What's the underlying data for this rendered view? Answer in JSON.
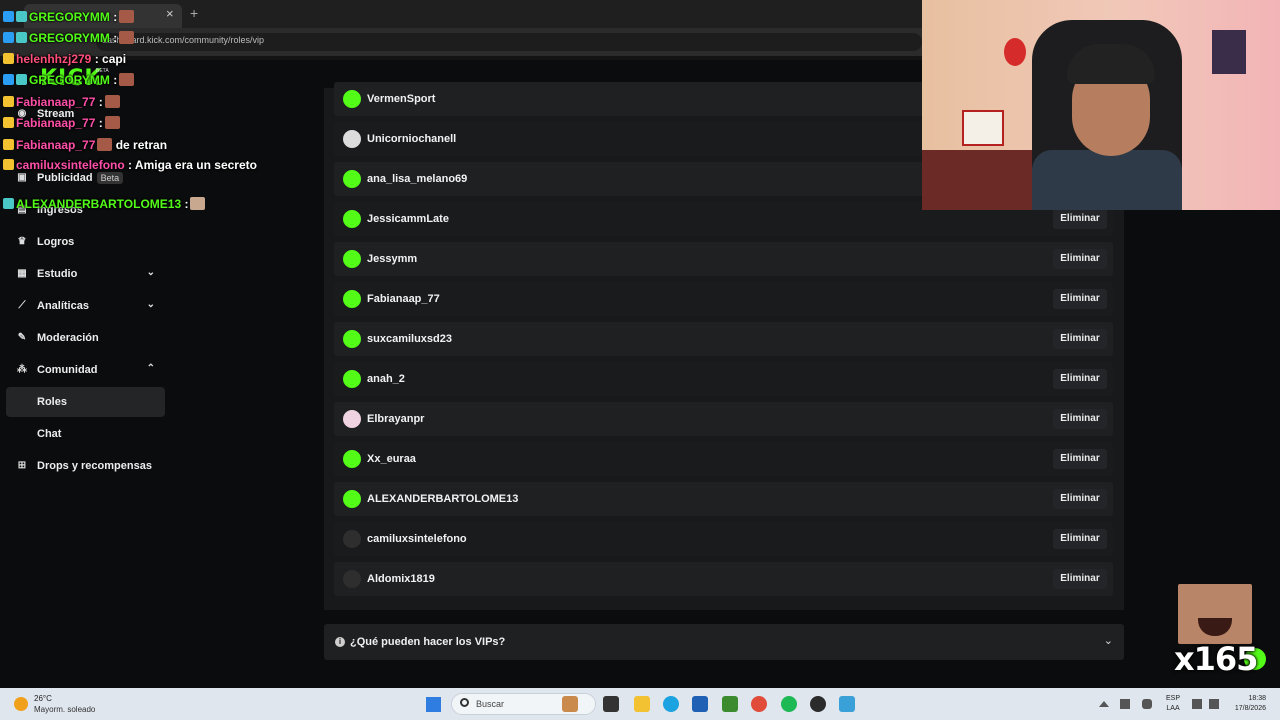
{
  "browser": {
    "url": "dashboard.kick.com/community/roles/vip",
    "tab_close": "×",
    "tab_new": "+"
  },
  "sidebar": {
    "logo": "KICK",
    "logo_badge": "BETA",
    "items": [
      {
        "label": "Stream",
        "icon": "broadcast-icon",
        "glyph": "◉"
      },
      {
        "label": "Publicidad",
        "icon": "ad-icon",
        "glyph": "▣",
        "badge": "Beta"
      },
      {
        "label": "Ingresos",
        "icon": "wallet-icon",
        "glyph": "▤"
      },
      {
        "label": "Logros",
        "icon": "trophy-icon",
        "glyph": "♛"
      },
      {
        "label": "Estudio",
        "icon": "studio-icon",
        "glyph": "▦",
        "chevron": "⌄"
      },
      {
        "label": "Analíticas",
        "icon": "chart-icon",
        "glyph": "⟋",
        "chevron": "⌄"
      },
      {
        "label": "Moderación",
        "icon": "wrench-icon",
        "glyph": "✎"
      },
      {
        "label": "Comunidad",
        "icon": "community-icon",
        "glyph": "⁂",
        "chevron": "⌃"
      },
      {
        "label": "Roles",
        "active": true
      },
      {
        "label": "Chat"
      },
      {
        "label": "Drops y recompensas",
        "icon": "gift-icon",
        "glyph": "⊞"
      }
    ]
  },
  "vips": [
    {
      "name": "VermenSport",
      "avatar": "green"
    },
    {
      "name": "Unicorniochanell",
      "avatar": "plain",
      "action": "Eliminar"
    },
    {
      "name": "ana_lisa_melano69",
      "avatar": "green",
      "action": "Eliminar"
    },
    {
      "name": "JessicammLate",
      "avatar": "green",
      "action": "Eliminar"
    },
    {
      "name": "Jessymm",
      "avatar": "green",
      "action": "Eliminar"
    },
    {
      "name": "Fabianaap_77",
      "avatar": "green",
      "action": "Eliminar"
    },
    {
      "name": "suxcamiluxsd23",
      "avatar": "green",
      "action": "Eliminar"
    },
    {
      "name": "anah_2",
      "avatar": "green",
      "action": "Eliminar"
    },
    {
      "name": "Elbrayanpr",
      "avatar": "pink",
      "action": "Eliminar"
    },
    {
      "name": "Xx_euraa",
      "avatar": "green",
      "action": "Eliminar"
    },
    {
      "name": "ALEXANDERBARTOLOME13",
      "avatar": "green",
      "action": "Eliminar"
    },
    {
      "name": "camiluxsintelefono",
      "avatar": "dark",
      "action": "Eliminar"
    },
    {
      "name": "Aldomix1819",
      "avatar": "dark",
      "action": "Eliminar"
    }
  ],
  "faq": {
    "question": "¿Qué pueden hacer los VIPs?",
    "info": "i",
    "chevron": "⌄"
  },
  "chat": [
    {
      "user": "GREGORYMM",
      "color": "#53fc18",
      "text": " :",
      "badges": [
        "blue",
        "teal"
      ],
      "emote": true
    },
    {
      "user": "GREGORYMM",
      "color": "#53fc18",
      "text": " :",
      "badges": [
        "blue",
        "teal"
      ],
      "emote": true
    },
    {
      "user": "helenhhzj279",
      "color": "#ff4f7a",
      "text": " : capi",
      "badges": [
        "gold"
      ]
    },
    {
      "user": "GREGORYMM",
      "color": "#53fc18",
      "text": " :",
      "badges": [
        "blue",
        "teal"
      ],
      "emote": true
    },
    {
      "user": "Fabianaap_77",
      "color": "#ff4fa8",
      "text": " :",
      "badges": [
        "gold"
      ],
      "emote": true
    },
    {
      "user": "Fabianaap_77",
      "color": "#ff4fa8",
      "text": " :",
      "badges": [
        "gold"
      ],
      "emote": true
    },
    {
      "user": "Fabianaap_77",
      "color": "#ff4fa8",
      "text": " de retran",
      "badges": [
        "gold"
      ],
      "emote": true
    },
    {
      "user": "camiluxsintelefono",
      "color": "#ff4fa8",
      "text": " : Amiga era un secreto",
      "badges": [
        "gold"
      ]
    },
    {
      "user": "ALEXANDERBARTOLOME13",
      "color": "#53fc18",
      "text": " :",
      "badges": [
        "teal"
      ],
      "emote_light": true
    }
  ],
  "sticker": {
    "count": "x165"
  },
  "taskbar": {
    "temperature": "26°C",
    "condition": "Mayorm. soleado",
    "search_placeholder": "Buscar",
    "lang_top": "ESP",
    "lang_bottom": "LAA",
    "time": "18:38",
    "date": "17/8/2026"
  },
  "colors": {
    "kick_green": "#53fc18",
    "panel_bg": "#18191b",
    "row_bg": "#1f2022",
    "sidebar_active": "#232527"
  }
}
